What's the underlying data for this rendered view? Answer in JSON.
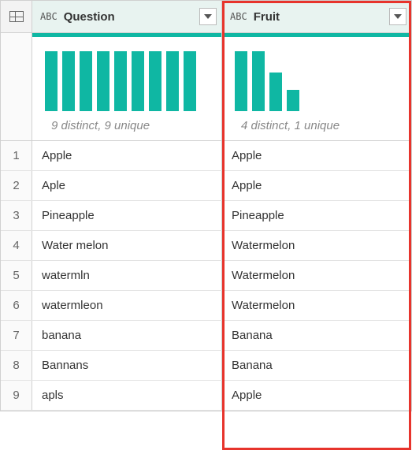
{
  "columns": [
    {
      "name": "Question",
      "type_glyph": "ABC",
      "distinct_label": "9 distinct, 9 unique"
    },
    {
      "name": "Fruit",
      "type_glyph": "ABC",
      "distinct_label": "4 distinct, 1 unique"
    }
  ],
  "rows": [
    {
      "idx": "1",
      "c0": "Apple",
      "c1": "Apple"
    },
    {
      "idx": "2",
      "c0": "Aple",
      "c1": "Apple"
    },
    {
      "idx": "3",
      "c0": "Pineapple",
      "c1": "Pineapple"
    },
    {
      "idx": "4",
      "c0": "Water melon",
      "c1": "Watermelon"
    },
    {
      "idx": "5",
      "c0": "watermln",
      "c1": "Watermelon"
    },
    {
      "idx": "6",
      "c0": "watermleon",
      "c1": "Watermelon"
    },
    {
      "idx": "7",
      "c0": "banana",
      "c1": "Banana"
    },
    {
      "idx": "8",
      "c0": "Bannans",
      "c1": "Banana"
    },
    {
      "idx": "9",
      "c0": "apls",
      "c1": "Apple"
    }
  ],
  "chart_data": [
    {
      "type": "bar",
      "title": "Question value distribution",
      "values": [
        100,
        100,
        100,
        100,
        100,
        100,
        100,
        100,
        100
      ],
      "summary": "9 distinct, 9 unique"
    },
    {
      "type": "bar",
      "title": "Fruit value distribution",
      "values": [
        100,
        100,
        65,
        35
      ],
      "summary": "4 distinct, 1 unique"
    }
  ]
}
